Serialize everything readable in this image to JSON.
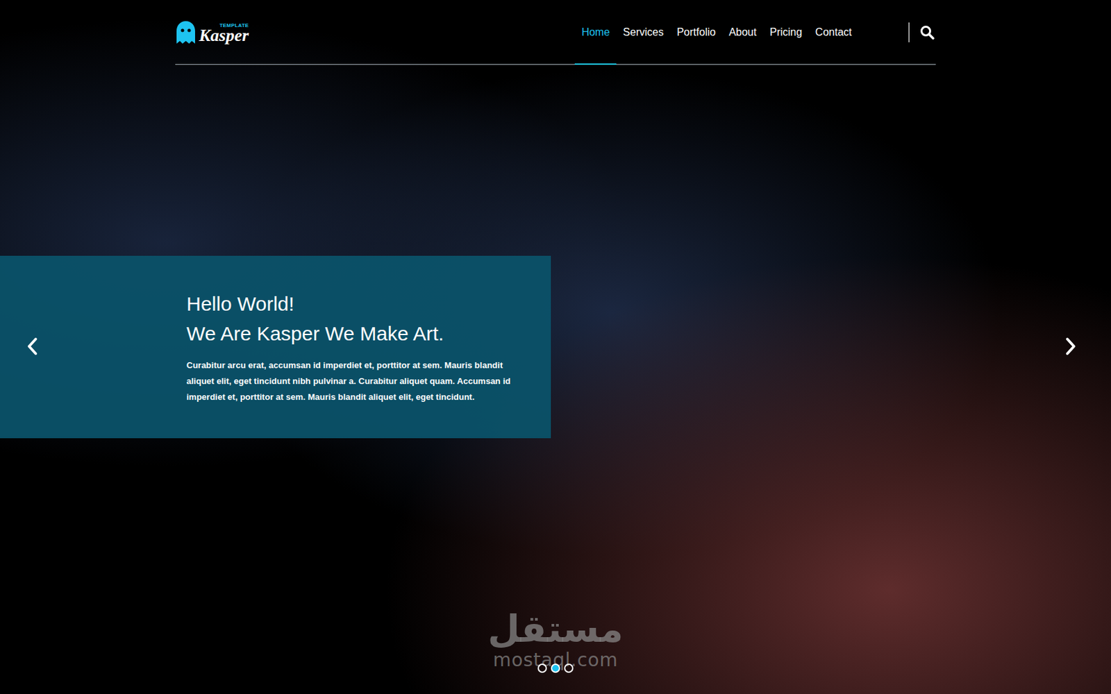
{
  "logo": {
    "name": "Kasper",
    "tag": "TEMPLATE"
  },
  "nav": [
    {
      "label": "Home",
      "selected": true
    },
    {
      "label": "Services",
      "selected": false
    },
    {
      "label": "Portfolio",
      "selected": false
    },
    {
      "label": "About",
      "selected": false
    },
    {
      "label": "Pricing",
      "selected": false
    },
    {
      "label": "Contact",
      "selected": false
    }
  ],
  "hero": {
    "line1": "Hello World!",
    "line2": "We Are Kasper We Make Art.",
    "text": "Curabitur arcu erat, accumsan id imperdiet et, porttitor at sem. Mauris blandit aliquet elit, eget tincidunt nibh pulvinar a. Curabitur aliquet quam. Accumsan id imperdiet et, porttitor at sem. Mauris blandit aliquet elit, eget tincidunt."
  },
  "dots": [
    {
      "selected": false
    },
    {
      "selected": true
    },
    {
      "selected": false
    }
  ],
  "watermark": {
    "arabic": "مستقل",
    "latin": "mostaql.com"
  }
}
